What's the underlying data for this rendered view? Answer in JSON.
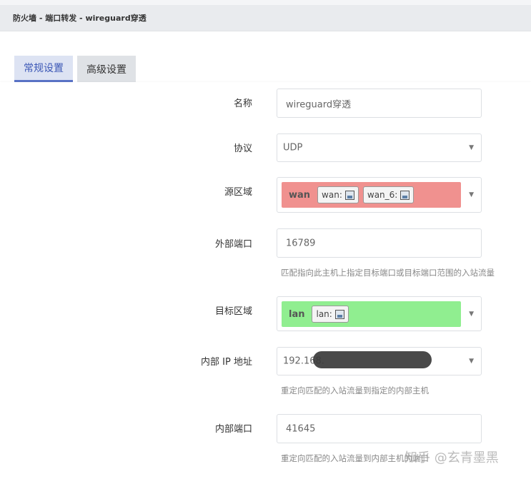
{
  "breadcrumb": "防火墙 - 端口转发 - wireguard穿透",
  "tabs": [
    {
      "label": "常规设置",
      "active": true
    },
    {
      "label": "高级设置",
      "active": false
    }
  ],
  "form": {
    "name": {
      "label": "名称",
      "value": "wireguard穿透"
    },
    "protocol": {
      "label": "协议",
      "value": "UDP"
    },
    "src_zone": {
      "label": "源区域",
      "zone": "wan",
      "chips": [
        "wan:",
        "wan_6:"
      ],
      "color": "#f0918f"
    },
    "external_port": {
      "label": "外部端口",
      "value": "16789",
      "hint": "匹配指向此主机上指定目标端口或目标端口范围的入站流量"
    },
    "dest_zone": {
      "label": "目标区域",
      "zone": "lan",
      "chips": [
        "lan:"
      ],
      "color": "#90ee90"
    },
    "internal_ip": {
      "label": "内部 IP 地址",
      "value": "192.168.",
      "hint": "重定向匹配的入站流量到指定的内部主机"
    },
    "internal_port": {
      "label": "内部端口",
      "value": "41645",
      "hint": "重定向匹配的入站流量到内部主机的端口"
    }
  },
  "watermark": "知乎 @玄青墨黑",
  "colors": {
    "accent": "#5a73c7",
    "wan": "#f0918f",
    "lan": "#90ee90"
  }
}
